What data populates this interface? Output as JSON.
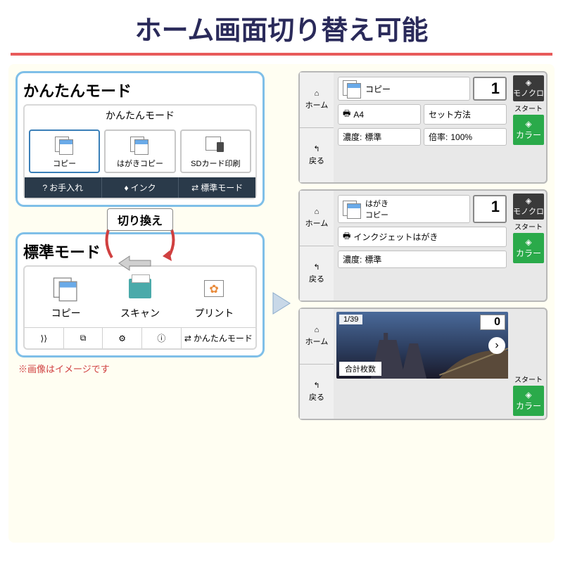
{
  "header": "ホーム画面切り替え可能",
  "easy_mode": {
    "title": "かんたんモード",
    "screen_header": "かんたんモード",
    "buttons": [
      {
        "label": "コピー"
      },
      {
        "label": "はがきコピー"
      },
      {
        "label": "SDカード印刷"
      }
    ],
    "bottom": [
      {
        "label": "お手入れ"
      },
      {
        "label": "インク"
      },
      {
        "label": "標準モード"
      }
    ]
  },
  "switch_label": "切り換え",
  "std_mode": {
    "title": "標準モード",
    "icons": [
      {
        "label": "コピー"
      },
      {
        "label": "スキャン"
      },
      {
        "label": "プリント"
      }
    ],
    "bottom_mode": "かんたんモード"
  },
  "detail1": {
    "side_home": "ホーム",
    "side_back": "戻る",
    "title": "コピー",
    "count": "1",
    "paper": "A4",
    "set": "セット方法",
    "density_label": "濃度:",
    "density_val": "標準",
    "ratio_label": "倍率:",
    "ratio_val": "100%",
    "mono": "モノクロ",
    "start": "スタート",
    "color": "カラー"
  },
  "detail2": {
    "side_home": "ホーム",
    "side_back": "戻る",
    "title": "はがき\nコピー",
    "count": "1",
    "paper": "インクジェットはがき",
    "density_label": "濃度:",
    "density_val": "標準",
    "mono": "モノクロ",
    "start": "スタート",
    "color": "カラー"
  },
  "detail3": {
    "side_home": "ホーム",
    "side_back": "戻る",
    "page": "1/39",
    "count": "0",
    "total_label": "合計枚数",
    "start": "スタート",
    "color": "カラー"
  },
  "footnote": "※画像はイメージです"
}
